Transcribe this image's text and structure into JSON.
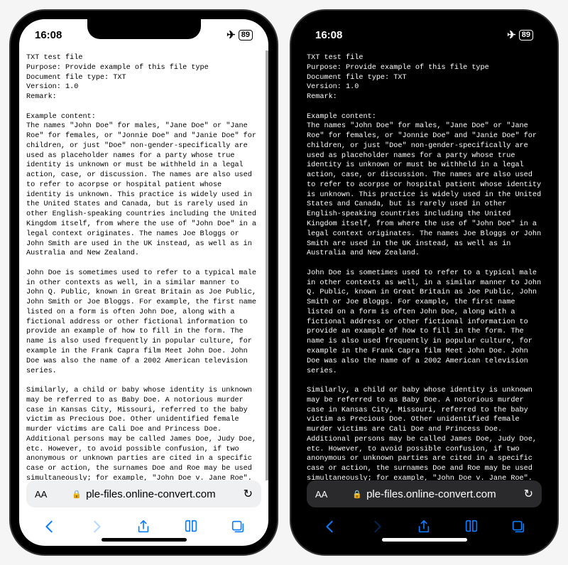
{
  "status": {
    "time": "16:08",
    "airplane": "✈",
    "battery": "89"
  },
  "document": {
    "header": "TXT test file\nPurpose: Provide example of this file type\nDocument file type: TXT\nVersion: 1.0\nRemark:",
    "section_title": "Example content:",
    "para1": "The names \"John Doe\" for males, \"Jane Doe\" or \"Jane Roe\" for females, or \"Jonnie Doe\" and \"Janie Doe\" for children, or just \"Doe\" non-gender-specifically are used as placeholder names for a party whose true identity is unknown or must be withheld in a legal action, case, or discussion. The names are also used to refer to acorpse or hospital patient whose identity is unknown. This practice is widely used in the United States and Canada, but is rarely used in other English-speaking countries including the United Kingdom itself, from where the use of \"John Doe\" in a legal context originates. The names Joe Bloggs or John Smith are used in the UK instead, as well as in Australia and New Zealand.",
    "para2": "John Doe is sometimes used to refer to a typical male in other contexts as well, in a similar manner to John Q. Public, known in Great Britain as Joe Public, John Smith or Joe Bloggs. For example, the first name listed on a form is often John Doe, along with a fictional address or other fictional information to provide an example of how to fill in the form. The name is also used frequently in popular culture, for example in the Frank Capra film Meet John Doe. John Doe was also the name of a 2002 American television series.",
    "para3": "Similarly, a child or baby whose identity is unknown may be referred to as Baby Doe. A notorious murder case in Kansas City, Missouri, referred to the baby victim as Precious Doe. Other unidentified female murder victims are Cali Doe and Princess Doe. Additional persons may be called James Doe, Judy Doe, etc. However, to avoid possible confusion, if two anonymous or unknown parties are cited in a specific case or action, the surnames Doe and Roe may be used simultaneously; for example, \"John Doe v. Jane Roe\". If several anonymous parties are referenced, they may simply be labelled John Doe #1, John Doe #2, etc. (the U.S. Operation Delego cited 21 (numbered) \"John Doe\"s) or labelled with other variants of Doe / Roe / Poe / etc. Other early alternatives such as John"
  },
  "urlbar": {
    "aa": "AA",
    "lock": "🔒",
    "text": "ple-files.online-convert.com",
    "reload": "↻"
  }
}
